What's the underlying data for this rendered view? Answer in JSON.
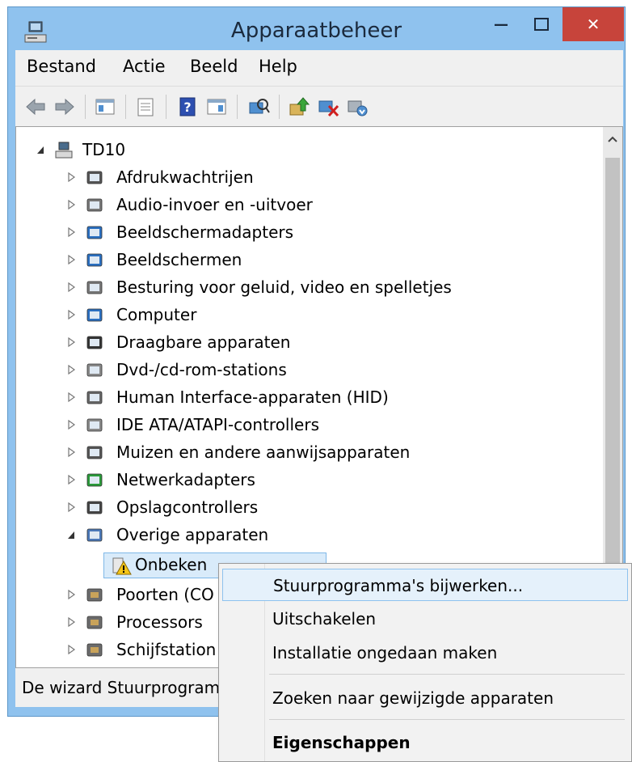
{
  "window": {
    "title": "Apparaatbeheer",
    "minimize_glyph": "—",
    "close_glyph": "✕"
  },
  "menubar": {
    "items": [
      "Bestand",
      "Actie",
      "Beeld",
      "Help"
    ]
  },
  "toolbar": {
    "buttons": [
      "back-arrow-icon",
      "forward-arrow-icon",
      "console-tree-icon",
      "properties-icon",
      "help-icon",
      "show-action-pane-icon",
      "scan-hardware-icon",
      "update-driver-icon",
      "disable-device-icon",
      "uninstall-device-icon"
    ]
  },
  "tree": {
    "root": "TD10",
    "categories": [
      "Afdrukwachtrijen",
      "Audio-invoer en -uitvoer",
      "Beeldschermadapters",
      "Beeldschermen",
      "Besturing voor geluid, video en spelletjes",
      "Computer",
      "Draagbare apparaten",
      "Dvd-/cd-rom-stations",
      "Human Interface-apparaten (HID)",
      "IDE ATA/ATAPI-controllers",
      "Muizen en andere aanwijsapparaten",
      "Netwerkadapters",
      "Opslagcontrollers",
      "Overige apparaten"
    ],
    "selected_device": "Onbeken",
    "categories_after": [
      "Poorten (CO",
      "Processors",
      "Schijfstation"
    ]
  },
  "statusbar": {
    "text": "De wizard Stuurprogram"
  },
  "context_menu": {
    "items": [
      "Stuurprogramma's bijwerken...",
      "Uitschakelen",
      "Installatie ongedaan maken",
      "Zoeken naar gewijzigde apparaten",
      "Eigenschappen"
    ]
  },
  "colors": {
    "title_bar": "#8fc2ee",
    "close_button": "#c7443b",
    "selection": "#d9ebfa",
    "warning": "#f5c518"
  }
}
